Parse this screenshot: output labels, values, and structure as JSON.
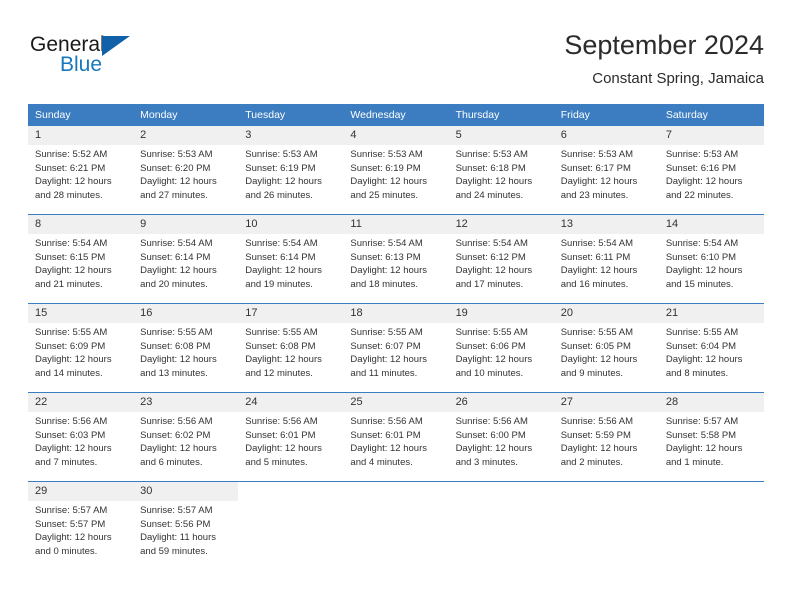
{
  "brand": {
    "name_part1": "General",
    "name_part2": "Blue",
    "triangle_color": "#1061a8",
    "blue_color": "#1878bd"
  },
  "header": {
    "title": "September 2024",
    "subtitle": "Constant Spring, Jamaica"
  },
  "theme": {
    "header_bg": "#3b7dc0",
    "header_text": "#ffffff",
    "daynum_bg": "#f0f0f0",
    "row_divider": "#3b7dc0",
    "body_text": "#333333"
  },
  "weekdays": [
    "Sunday",
    "Monday",
    "Tuesday",
    "Wednesday",
    "Thursday",
    "Friday",
    "Saturday"
  ],
  "weeks": [
    [
      {
        "day": "1",
        "sunrise": "Sunrise: 5:52 AM",
        "sunset": "Sunset: 6:21 PM",
        "daylight1": "Daylight: 12 hours",
        "daylight2": "and 28 minutes."
      },
      {
        "day": "2",
        "sunrise": "Sunrise: 5:53 AM",
        "sunset": "Sunset: 6:20 PM",
        "daylight1": "Daylight: 12 hours",
        "daylight2": "and 27 minutes."
      },
      {
        "day": "3",
        "sunrise": "Sunrise: 5:53 AM",
        "sunset": "Sunset: 6:19 PM",
        "daylight1": "Daylight: 12 hours",
        "daylight2": "and 26 minutes."
      },
      {
        "day": "4",
        "sunrise": "Sunrise: 5:53 AM",
        "sunset": "Sunset: 6:19 PM",
        "daylight1": "Daylight: 12 hours",
        "daylight2": "and 25 minutes."
      },
      {
        "day": "5",
        "sunrise": "Sunrise: 5:53 AM",
        "sunset": "Sunset: 6:18 PM",
        "daylight1": "Daylight: 12 hours",
        "daylight2": "and 24 minutes."
      },
      {
        "day": "6",
        "sunrise": "Sunrise: 5:53 AM",
        "sunset": "Sunset: 6:17 PM",
        "daylight1": "Daylight: 12 hours",
        "daylight2": "and 23 minutes."
      },
      {
        "day": "7",
        "sunrise": "Sunrise: 5:53 AM",
        "sunset": "Sunset: 6:16 PM",
        "daylight1": "Daylight: 12 hours",
        "daylight2": "and 22 minutes."
      }
    ],
    [
      {
        "day": "8",
        "sunrise": "Sunrise: 5:54 AM",
        "sunset": "Sunset: 6:15 PM",
        "daylight1": "Daylight: 12 hours",
        "daylight2": "and 21 minutes."
      },
      {
        "day": "9",
        "sunrise": "Sunrise: 5:54 AM",
        "sunset": "Sunset: 6:14 PM",
        "daylight1": "Daylight: 12 hours",
        "daylight2": "and 20 minutes."
      },
      {
        "day": "10",
        "sunrise": "Sunrise: 5:54 AM",
        "sunset": "Sunset: 6:14 PM",
        "daylight1": "Daylight: 12 hours",
        "daylight2": "and 19 minutes."
      },
      {
        "day": "11",
        "sunrise": "Sunrise: 5:54 AM",
        "sunset": "Sunset: 6:13 PM",
        "daylight1": "Daylight: 12 hours",
        "daylight2": "and 18 minutes."
      },
      {
        "day": "12",
        "sunrise": "Sunrise: 5:54 AM",
        "sunset": "Sunset: 6:12 PM",
        "daylight1": "Daylight: 12 hours",
        "daylight2": "and 17 minutes."
      },
      {
        "day": "13",
        "sunrise": "Sunrise: 5:54 AM",
        "sunset": "Sunset: 6:11 PM",
        "daylight1": "Daylight: 12 hours",
        "daylight2": "and 16 minutes."
      },
      {
        "day": "14",
        "sunrise": "Sunrise: 5:54 AM",
        "sunset": "Sunset: 6:10 PM",
        "daylight1": "Daylight: 12 hours",
        "daylight2": "and 15 minutes."
      }
    ],
    [
      {
        "day": "15",
        "sunrise": "Sunrise: 5:55 AM",
        "sunset": "Sunset: 6:09 PM",
        "daylight1": "Daylight: 12 hours",
        "daylight2": "and 14 minutes."
      },
      {
        "day": "16",
        "sunrise": "Sunrise: 5:55 AM",
        "sunset": "Sunset: 6:08 PM",
        "daylight1": "Daylight: 12 hours",
        "daylight2": "and 13 minutes."
      },
      {
        "day": "17",
        "sunrise": "Sunrise: 5:55 AM",
        "sunset": "Sunset: 6:08 PM",
        "daylight1": "Daylight: 12 hours",
        "daylight2": "and 12 minutes."
      },
      {
        "day": "18",
        "sunrise": "Sunrise: 5:55 AM",
        "sunset": "Sunset: 6:07 PM",
        "daylight1": "Daylight: 12 hours",
        "daylight2": "and 11 minutes."
      },
      {
        "day": "19",
        "sunrise": "Sunrise: 5:55 AM",
        "sunset": "Sunset: 6:06 PM",
        "daylight1": "Daylight: 12 hours",
        "daylight2": "and 10 minutes."
      },
      {
        "day": "20",
        "sunrise": "Sunrise: 5:55 AM",
        "sunset": "Sunset: 6:05 PM",
        "daylight1": "Daylight: 12 hours",
        "daylight2": "and 9 minutes."
      },
      {
        "day": "21",
        "sunrise": "Sunrise: 5:55 AM",
        "sunset": "Sunset: 6:04 PM",
        "daylight1": "Daylight: 12 hours",
        "daylight2": "and 8 minutes."
      }
    ],
    [
      {
        "day": "22",
        "sunrise": "Sunrise: 5:56 AM",
        "sunset": "Sunset: 6:03 PM",
        "daylight1": "Daylight: 12 hours",
        "daylight2": "and 7 minutes."
      },
      {
        "day": "23",
        "sunrise": "Sunrise: 5:56 AM",
        "sunset": "Sunset: 6:02 PM",
        "daylight1": "Daylight: 12 hours",
        "daylight2": "and 6 minutes."
      },
      {
        "day": "24",
        "sunrise": "Sunrise: 5:56 AM",
        "sunset": "Sunset: 6:01 PM",
        "daylight1": "Daylight: 12 hours",
        "daylight2": "and 5 minutes."
      },
      {
        "day": "25",
        "sunrise": "Sunrise: 5:56 AM",
        "sunset": "Sunset: 6:01 PM",
        "daylight1": "Daylight: 12 hours",
        "daylight2": "and 4 minutes."
      },
      {
        "day": "26",
        "sunrise": "Sunrise: 5:56 AM",
        "sunset": "Sunset: 6:00 PM",
        "daylight1": "Daylight: 12 hours",
        "daylight2": "and 3 minutes."
      },
      {
        "day": "27",
        "sunrise": "Sunrise: 5:56 AM",
        "sunset": "Sunset: 5:59 PM",
        "daylight1": "Daylight: 12 hours",
        "daylight2": "and 2 minutes."
      },
      {
        "day": "28",
        "sunrise": "Sunrise: 5:57 AM",
        "sunset": "Sunset: 5:58 PM",
        "daylight1": "Daylight: 12 hours",
        "daylight2": "and 1 minute."
      }
    ],
    [
      {
        "day": "29",
        "sunrise": "Sunrise: 5:57 AM",
        "sunset": "Sunset: 5:57 PM",
        "daylight1": "Daylight: 12 hours",
        "daylight2": "and 0 minutes."
      },
      {
        "day": "30",
        "sunrise": "Sunrise: 5:57 AM",
        "sunset": "Sunset: 5:56 PM",
        "daylight1": "Daylight: 11 hours",
        "daylight2": "and 59 minutes."
      },
      {
        "day": "",
        "sunrise": "",
        "sunset": "",
        "daylight1": "",
        "daylight2": ""
      },
      {
        "day": "",
        "sunrise": "",
        "sunset": "",
        "daylight1": "",
        "daylight2": ""
      },
      {
        "day": "",
        "sunrise": "",
        "sunset": "",
        "daylight1": "",
        "daylight2": ""
      },
      {
        "day": "",
        "sunrise": "",
        "sunset": "",
        "daylight1": "",
        "daylight2": ""
      },
      {
        "day": "",
        "sunrise": "",
        "sunset": "",
        "daylight1": "",
        "daylight2": ""
      }
    ]
  ]
}
